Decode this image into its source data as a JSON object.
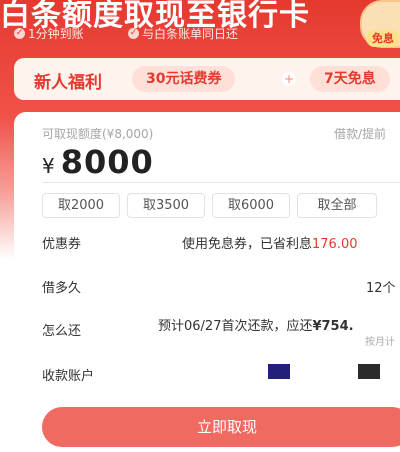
{
  "header": {
    "title": "白条额度取现至银行卡",
    "features": [
      "1分钟到账",
      "与白条账单同日还"
    ],
    "mascot_tag": "免息"
  },
  "promo": {
    "title": "新人福利",
    "coupons": [
      "30元话费券",
      "7天免息"
    ],
    "separator": "+"
  },
  "withdraw": {
    "available_label": "可取现额度(¥8,000)",
    "right_hint": "借款/提前",
    "currency_symbol": "¥",
    "amount": "8000",
    "quick_amounts": [
      "取2000",
      "取3500",
      "取6000",
      "取全部"
    ]
  },
  "details": {
    "coupon_label": "优惠券",
    "coupon_text": "使用免息券，已省利息",
    "coupon_saved": "176.00",
    "term_label": "借多久",
    "term_value": "12个",
    "repay_label": "怎么还",
    "repay_text": "预计06/27首次还款，应还",
    "repay_amount": "¥754.",
    "repay_sub": "按月计",
    "account_label": "收款账户"
  },
  "cta": {
    "label": "立即取现"
  },
  "colors": {
    "brand_red": "#e5392f",
    "cta": "#f06a61",
    "account_square_1": "#23207a",
    "account_square_2": "#2b2b2b"
  }
}
